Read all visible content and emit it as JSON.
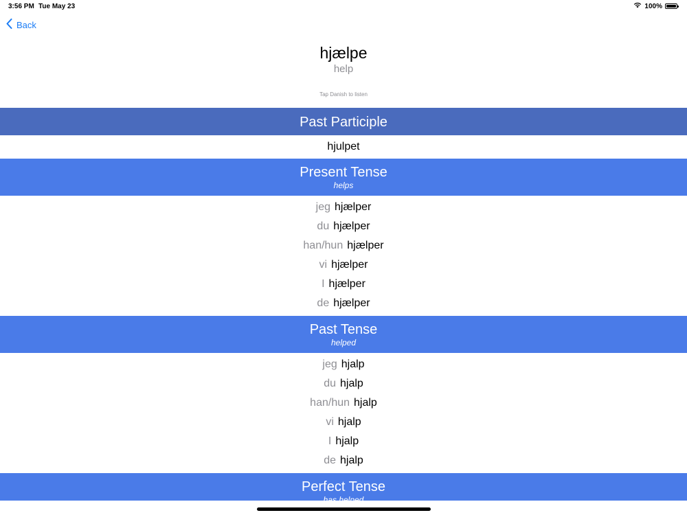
{
  "status_bar": {
    "time": "3:56 PM",
    "date": "Tue May 23",
    "battery": "100%"
  },
  "nav": {
    "back_label": "Back"
  },
  "word": {
    "danish": "hjælpe",
    "english": "help",
    "hint": "Tap Danish to listen"
  },
  "past_participle": {
    "title": "Past Participle",
    "value": "hjulpet"
  },
  "present_tense": {
    "title": "Present Tense",
    "subtitle": "helps",
    "rows": [
      {
        "pronoun": "jeg",
        "verb": "hjælper"
      },
      {
        "pronoun": "du",
        "verb": "hjælper"
      },
      {
        "pronoun": "han/hun",
        "verb": "hjælper"
      },
      {
        "pronoun": "vi",
        "verb": "hjælper"
      },
      {
        "pronoun": "I",
        "verb": "hjælper"
      },
      {
        "pronoun": "de",
        "verb": "hjælper"
      }
    ]
  },
  "past_tense": {
    "title": "Past Tense",
    "subtitle": "helped",
    "rows": [
      {
        "pronoun": "jeg",
        "verb": "hjalp"
      },
      {
        "pronoun": "du",
        "verb": "hjalp"
      },
      {
        "pronoun": "han/hun",
        "verb": "hjalp"
      },
      {
        "pronoun": "vi",
        "verb": "hjalp"
      },
      {
        "pronoun": "I",
        "verb": "hjalp"
      },
      {
        "pronoun": "de",
        "verb": "hjalp"
      }
    ]
  },
  "perfect_tense": {
    "title": "Perfect Tense",
    "subtitle": "has helped"
  },
  "colors": {
    "accent": "#1a7cf5",
    "section_header": "#4a7be8",
    "participle_header": "#4a6bbd",
    "secondary_text": "#8e8e93"
  }
}
